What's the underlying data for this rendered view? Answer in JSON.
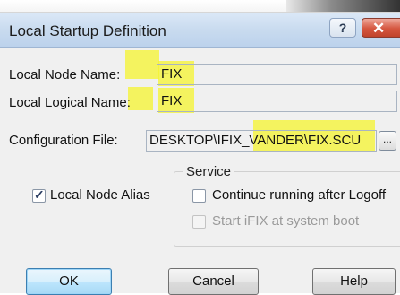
{
  "dialog": {
    "title": "Local Startup Definition",
    "title_buttons": {
      "help": "?",
      "close": "✕"
    }
  },
  "form": {
    "local_node_name": {
      "label": "Local Node Name:",
      "value": "FIX"
    },
    "local_logical_name": {
      "label": "Local Logical Name:",
      "value": "FIX"
    },
    "configuration_file": {
      "label": "Configuration File:",
      "value": "DESKTOP\\IFIX_VANDER\\FIX.SCU",
      "browse_label": "..."
    }
  },
  "options": {
    "local_node_alias": {
      "label": "Local Node Alias",
      "checked": true
    }
  },
  "service": {
    "group_label": "Service",
    "continue_running": {
      "label": "Continue running after Logoff",
      "checked": false,
      "enabled": true
    },
    "start_at_boot": {
      "label": "Start iFIX at system boot",
      "checked": false,
      "enabled": false
    }
  },
  "buttons": {
    "ok": "OK",
    "cancel": "Cancel",
    "help": "Help"
  },
  "highlight_color": "#f6f42f"
}
